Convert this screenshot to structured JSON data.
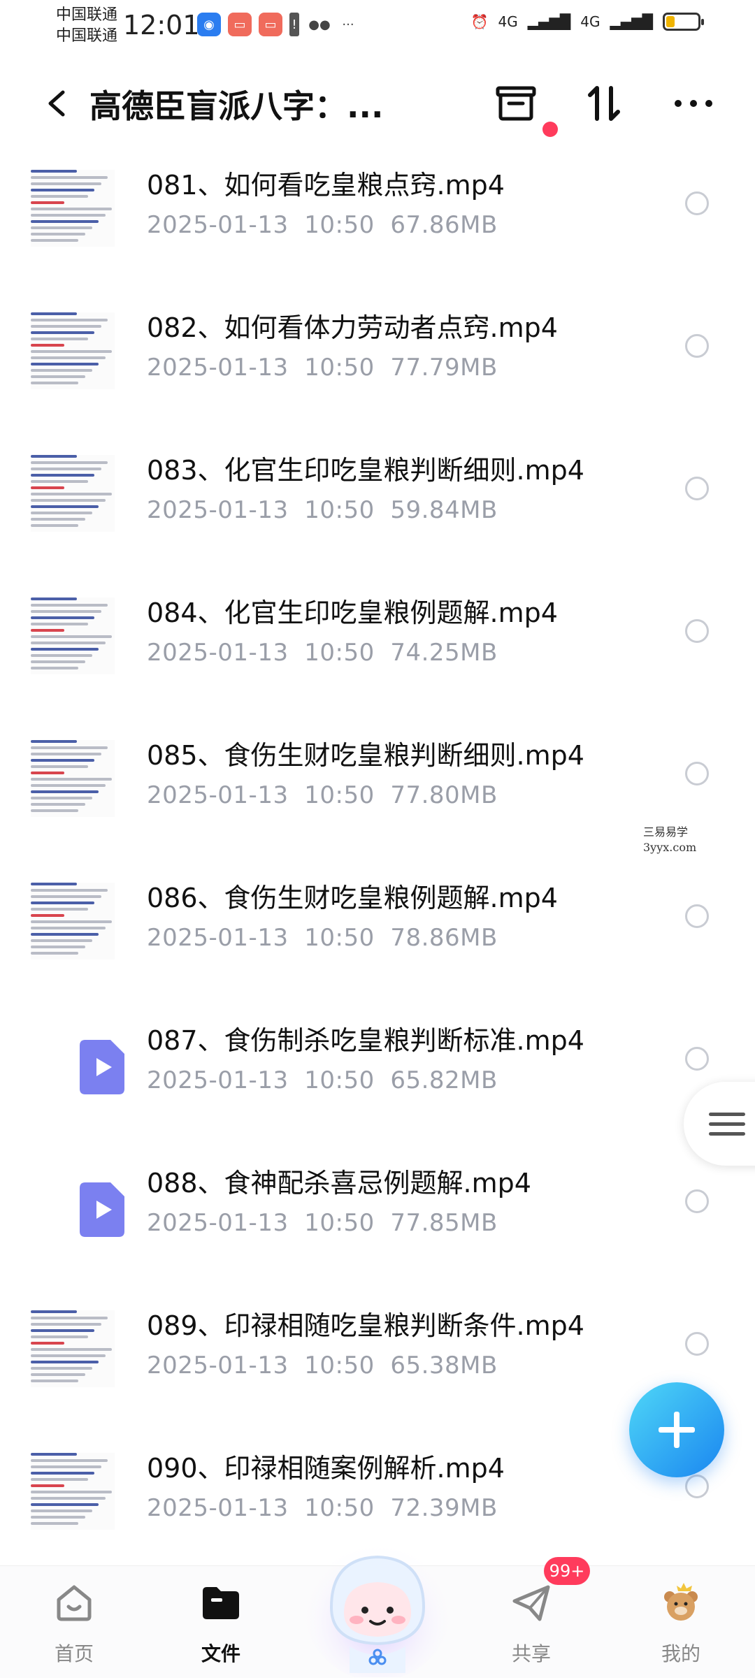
{
  "status_bar": {
    "carrier_1": "中国联通",
    "carrier_2": "中国联通",
    "time": "12:01",
    "net_1": "4G",
    "net_2": "4G"
  },
  "header": {
    "title": "高德臣盲派八字：..."
  },
  "files": [
    {
      "name": "081、如何看吃皇粮点窍.mp4",
      "date": "2025-01-13",
      "time": "10:50",
      "size": "67.86MB",
      "thumb": "doc"
    },
    {
      "name": "082、如何看体力劳动者点窍.mp4",
      "date": "2025-01-13",
      "time": "10:50",
      "size": "77.79MB",
      "thumb": "doc"
    },
    {
      "name": "083、化官生印吃皇粮判断细则.mp4",
      "date": "2025-01-13",
      "time": "10:50",
      "size": "59.84MB",
      "thumb": "doc"
    },
    {
      "name": "084、化官生印吃皇粮例题解.mp4",
      "date": "2025-01-13",
      "time": "10:50",
      "size": "74.25MB",
      "thumb": "doc"
    },
    {
      "name": "085、食伤生财吃皇粮判断细则.mp4",
      "date": "2025-01-13",
      "time": "10:50",
      "size": "77.80MB",
      "thumb": "doc"
    },
    {
      "name": "086、食伤生财吃皇粮例题解.mp4",
      "date": "2025-01-13",
      "time": "10:50",
      "size": "78.86MB",
      "thumb": "doc"
    },
    {
      "name": "087、食伤制杀吃皇粮判断标准.mp4",
      "date": "2025-01-13",
      "time": "10:50",
      "size": "65.82MB",
      "thumb": "video"
    },
    {
      "name": "088、食神配杀喜忌例题解.mp4",
      "date": "2025-01-13",
      "time": "10:50",
      "size": "77.85MB",
      "thumb": "video"
    },
    {
      "name": "089、印禄相随吃皇粮判断条件.mp4",
      "date": "2025-01-13",
      "time": "10:50",
      "size": "65.38MB",
      "thumb": "doc"
    },
    {
      "name": "090、印禄相随案例解析.mp4",
      "date": "2025-01-13",
      "time": "10:50",
      "size": "72.39MB",
      "thumb": "doc"
    }
  ],
  "watermark": {
    "line1": "三易易学",
    "line2": "3yyx.com"
  },
  "bottom_nav": {
    "home": "首页",
    "files": "文件",
    "share": "共享",
    "mine": "我的",
    "share_badge": "99+"
  },
  "colors": {
    "accent": "#1a86f0",
    "badge": "#ff3b5c",
    "video_icon": "#7b80f0",
    "meta_text": "#9a9ea8"
  },
  "icons": {
    "back": "chevron-left-icon",
    "archive": "archive-box-icon",
    "sort": "sort-arrows-icon",
    "more": "more-dots-icon",
    "add": "plus-icon",
    "menu": "hamburger-icon"
  }
}
